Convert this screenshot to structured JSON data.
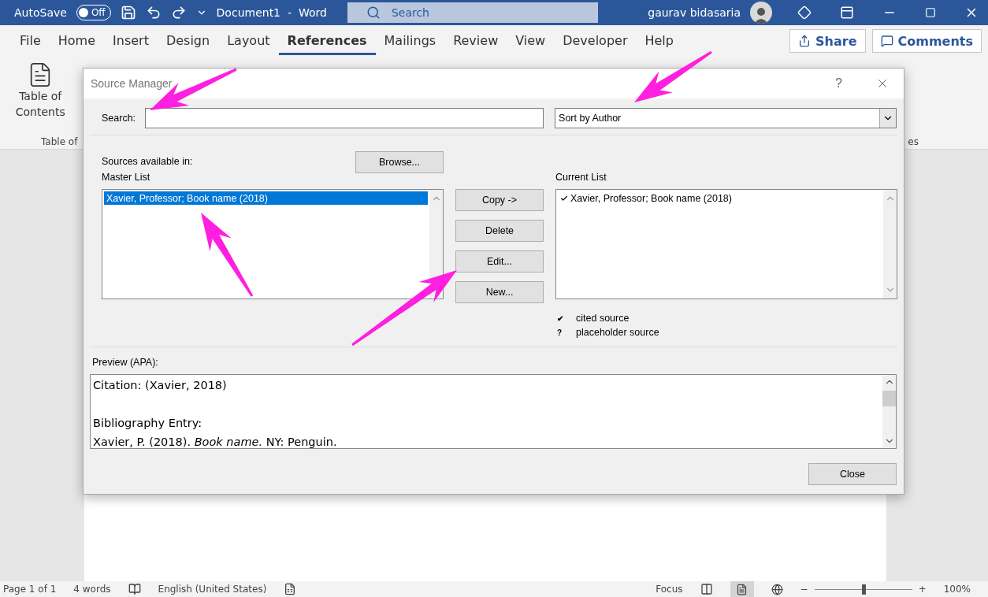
{
  "title_bar": {
    "autosave_label": "AutoSave",
    "autosave": {
      "on": false,
      "label": "Off"
    },
    "document_title": "Document1  -  Word",
    "search_placeholder": "Search",
    "user_name": "gaurav bidasaria"
  },
  "ribbon_tabs": [
    {
      "label": "File",
      "selected": false
    },
    {
      "label": "Home",
      "selected": false
    },
    {
      "label": "Insert",
      "selected": false
    },
    {
      "label": "Design",
      "selected": false
    },
    {
      "label": "Layout",
      "selected": false
    },
    {
      "label": "References",
      "selected": true
    },
    {
      "label": "Mailings",
      "selected": false
    },
    {
      "label": "Review",
      "selected": false
    },
    {
      "label": "View",
      "selected": false
    },
    {
      "label": "Developer",
      "selected": false
    },
    {
      "label": "Help",
      "selected": false
    }
  ],
  "share_button": "Share",
  "comments_button": "Comments",
  "ribbon": {
    "toc_button": "Table of\nContents",
    "group_labels": [
      "Table of",
      "es"
    ]
  },
  "dialog": {
    "title": "Source Manager",
    "help": "?",
    "search_label": "Search:",
    "sort": "Sort by Author",
    "sources_label": "Sources available in:",
    "browse_button": "Browse...",
    "master_list": {
      "label": "Master List",
      "items": [
        {
          "text": "Xavier, Professor; Book name (2018)",
          "selected": true
        }
      ]
    },
    "buttons": [
      "Copy ->",
      "Delete",
      "Edit...",
      "New..."
    ],
    "current_list": {
      "label": "Current List",
      "items": [
        {
          "text": "Xavier, Professor; Book name (2018)",
          "cited": true
        }
      ]
    },
    "legend": [
      {
        "symbol": "✔",
        "label": "cited source"
      },
      {
        "symbol": "?",
        "label": "placeholder source"
      }
    ],
    "preview_label": "Preview (APA):",
    "preview_blocks": [
      [
        "Citation:  (Xavier, 2018)"
      ],
      [
        "Bibliography Entry:",
        "Xavier, P. (2018). *Book name.* NY: Penguin."
      ]
    ],
    "close_button": "Close"
  },
  "status_bar": {
    "page": "Page 1 of 1",
    "words": "4 words",
    "language": "English (United States)",
    "focus": "Focus",
    "zoom_minus": "−",
    "zoom_plus": "+",
    "zoom": "100%",
    "zoom_slider": {
      "level": 0.5
    }
  }
}
